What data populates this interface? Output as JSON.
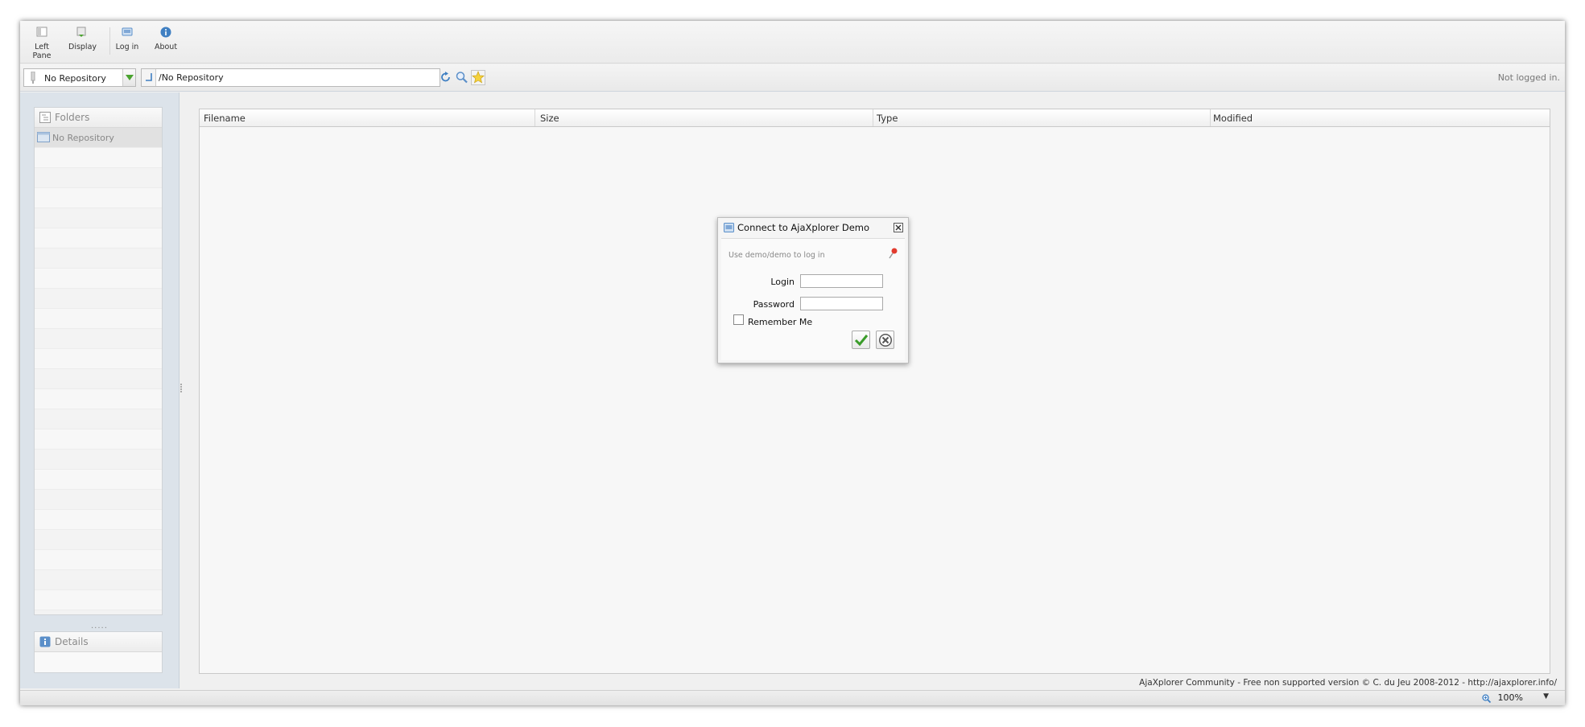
{
  "toolbar": {
    "left_pane": "Left Pane",
    "display": "Display",
    "log_in": "Log in",
    "about": "About"
  },
  "location": {
    "repository": "No Repository",
    "path": "/No Repository",
    "status": "Not logged in."
  },
  "left_pane": {
    "folders_title": "Folders",
    "folders": [
      "No Repository"
    ],
    "details_title": "Details"
  },
  "filelist": {
    "columns": [
      "Filename",
      "Size",
      "Type",
      "Modified"
    ]
  },
  "footer": "AjaXplorer Community - Free non supported version © C. du Jeu 2008-2012 - http://ajaxplorer.info/",
  "statusbar": {
    "zoom": "100%"
  },
  "dialog": {
    "title": "Connect to AjaXplorer Demo",
    "hint": "Use demo/demo to log in",
    "login_label": "Login",
    "password_label": "Password",
    "remember_label": "Remember Me",
    "login_value": "",
    "password_value": ""
  },
  "colors": {
    "accent_blue": "#5b8fc9",
    "ok_green": "#3a9c2a",
    "left_pane_bg": "#dce3ea"
  }
}
